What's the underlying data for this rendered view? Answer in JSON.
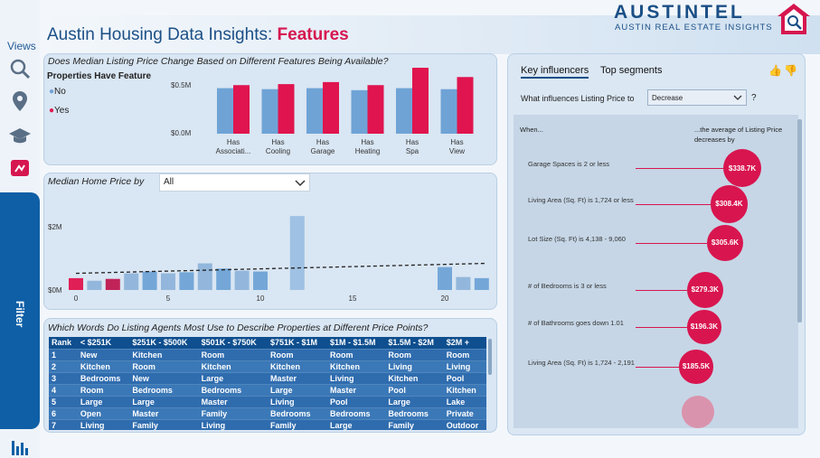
{
  "app": {
    "title_prefix": "Austin Housing Data Insights:",
    "title_section": "Features",
    "logo_main": "AUSTINTEL",
    "logo_sub": "AUSTIN REAL ESTATE INSIGHTS"
  },
  "rail": {
    "views_label": "Views",
    "filter_label": "Filter Panel",
    "icons": [
      "search-icon",
      "location-pin-icon",
      "graduation-cap-icon",
      "alert-flag-icon",
      "bar-chart-icon"
    ]
  },
  "features_chart": {
    "title": "Does Median Listing Price Change Based on Different Features Being Available?",
    "legend_title": "Properties Have Feature",
    "legend": [
      {
        "name": "No",
        "color": "#6fa3d6"
      },
      {
        "name": "Yes",
        "color": "#e0144e"
      }
    ],
    "y_ticks": [
      "$0.5M",
      "$0.0M"
    ]
  },
  "chart_data": [
    {
      "type": "bar",
      "title": "Does Median Listing Price Change Based on Different Features Being Available?",
      "categories": [
        "Has Associati...",
        "Has Cooling",
        "Has Garage",
        "Has Heating",
        "Has Spa",
        "Has View"
      ],
      "series": [
        {
          "name": "No",
          "values": [
            0.45,
            0.44,
            0.45,
            0.43,
            0.45,
            0.44
          ]
        },
        {
          "name": "Yes",
          "values": [
            0.48,
            0.49,
            0.51,
            0.48,
            0.68,
            0.56
          ]
        }
      ],
      "ylim": [
        0,
        0.75
      ]
    },
    {
      "type": "bar",
      "title": "Median Home Price by",
      "x": [
        0,
        1,
        2,
        3,
        4,
        5,
        6,
        7,
        8,
        9,
        10,
        11,
        12,
        13,
        14,
        15,
        16,
        17,
        18,
        19,
        20,
        21,
        22
      ],
      "values": [
        0.32,
        0.25,
        0.3,
        0.45,
        0.5,
        0.45,
        0.48,
        0.72,
        0.58,
        0.52,
        0.5,
        0.0,
        2.0,
        0.0,
        0.0,
        0.0,
        0.0,
        0.0,
        0.0,
        0.0,
        0.62,
        0.35,
        0.32
      ],
      "highlight_indices": [
        0,
        2
      ],
      "trend_line": {
        "from": 0.45,
        "to": 0.72
      },
      "y_ticks": [
        "$2M",
        "$0M"
      ],
      "x_ticks": [
        "0",
        "5",
        "10",
        "15",
        "20"
      ],
      "ylim": [
        0,
        2.15
      ]
    }
  ],
  "median_chart": {
    "title": "Median Home Price by",
    "dropdown_value": "All"
  },
  "words_table": {
    "title": "Which Words Do Listing Agents Most Use to Describe Properties at Different Price Points?",
    "headers": [
      "Rank",
      "< $251K",
      "$251K - $500K",
      "$501K - $750K",
      "$751K - $1M",
      "$1M - $1.5M",
      "$1.5M - $2M",
      "$2M +"
    ],
    "rows": [
      [
        "1",
        "New",
        "Kitchen",
        "Room",
        "Room",
        "Room",
        "Room",
        "Room"
      ],
      [
        "2",
        "Kitchen",
        "Room",
        "Kitchen",
        "Kitchen",
        "Kitchen",
        "Living",
        "Living"
      ],
      [
        "3",
        "Bedrooms",
        "New",
        "Large",
        "Master",
        "Living",
        "Kitchen",
        "Pool"
      ],
      [
        "4",
        "Room",
        "Bedrooms",
        "Bedrooms",
        "Large",
        "Master",
        "Pool",
        "Kitchen"
      ],
      [
        "5",
        "Large",
        "Large",
        "Master",
        "Living",
        "Pool",
        "Large",
        "Lake"
      ],
      [
        "6",
        "Open",
        "Master",
        "Family",
        "Bedrooms",
        "Bedrooms",
        "Bedrooms",
        "Private"
      ],
      [
        "7",
        "Living",
        "Family",
        "Living",
        "Family",
        "Large",
        "Family",
        "Outdoor"
      ]
    ]
  },
  "key_influencers": {
    "tab_active": "Key influencers",
    "tab_other": "Top segments",
    "question": "What influences Listing Price to",
    "dropdown_value": "Decrease",
    "question_mark": "?",
    "col_when": "When...",
    "col_avg": "...the average of Listing Price decreases by",
    "rows": [
      {
        "label": "Garage Spaces is 2 or less",
        "value": "$338.7K",
        "size": 1.0
      },
      {
        "label": "Living Area (Sq. Ft) is 1,724 or less",
        "value": "$308.4K",
        "size": 0.94
      },
      {
        "label": "Lot Size (Sq. Ft) is 4,138 - 9,060",
        "value": "$305.6K",
        "size": 0.93
      },
      {
        "label": "# of Bedrooms is 3 or less",
        "value": "$279.3K",
        "size": 0.88
      },
      {
        "label": "# of Bathrooms goes down 1.01",
        "value": "$196.3K",
        "size": 0.72
      },
      {
        "label": "Living Area (Sq. Ft) is 1,724 - 2,191",
        "value": "$185.5K",
        "size": 0.7
      }
    ]
  }
}
